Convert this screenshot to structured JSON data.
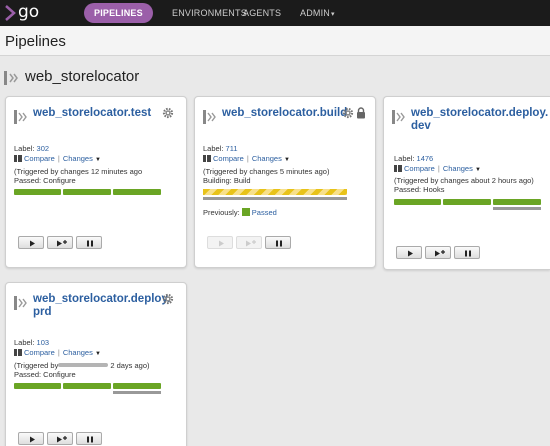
{
  "nav": {
    "logo": "go",
    "items": [
      {
        "label": "PIPELINES",
        "active": true
      },
      {
        "label": "ENVIRONMENTS",
        "active": false
      },
      {
        "label": "AGENTS",
        "active": false
      },
      {
        "label": "ADMIN",
        "active": false
      }
    ],
    "admin_caret": "▾"
  },
  "page": {
    "title": "Pipelines"
  },
  "group": {
    "name": "web_storelocator"
  },
  "pipelines": [
    {
      "name": "web_storelocator.test",
      "label_prefix": "Label: ",
      "label": "302",
      "compare": "Compare",
      "changes": "Changes",
      "triggered": "(Triggered by changes 12 minutes ago",
      "status": "Passed: Configure",
      "stages": [
        "passed",
        "passed",
        "passed"
      ]
    },
    {
      "name": "web_storelocator.build",
      "label_prefix": "Label: ",
      "label": "711",
      "compare": "Compare",
      "changes": "Changes",
      "triggered": "(Triggered by changes 5 minutes ago)",
      "status": "Building: Build",
      "stages": [
        "building"
      ],
      "previously_prefix": "Previously:",
      "previously": "Passed",
      "locked": true
    },
    {
      "name_line1": "web_storelocator.deploy.",
      "name_line2": "dev",
      "label_prefix": "Label: ",
      "label": "1476",
      "compare": "Compare",
      "changes": "Changes",
      "triggered": "(Triggered by changes about 2 hours ago)",
      "status": "Passed: Hooks",
      "stages": [
        "passed",
        "passed",
        "passed-grey"
      ]
    },
    {
      "name_line1": "web_storelocator.deploy.",
      "name_line2": "prd",
      "label_prefix": "Label: ",
      "label": "103",
      "compare": "Compare",
      "changes": "Changes",
      "triggered_prefix": "(Triggered by",
      "triggered_suffix": "2 days ago)",
      "status": "Passed: Configure",
      "stages": [
        "passed",
        "passed",
        "passed-grey"
      ]
    }
  ],
  "colors": {
    "nav_bg": "#1b1b1b",
    "active_tab": "#9b5fa9",
    "link": "#2c5fa0",
    "passed": "#6aa524",
    "building": "#e8c31a"
  }
}
